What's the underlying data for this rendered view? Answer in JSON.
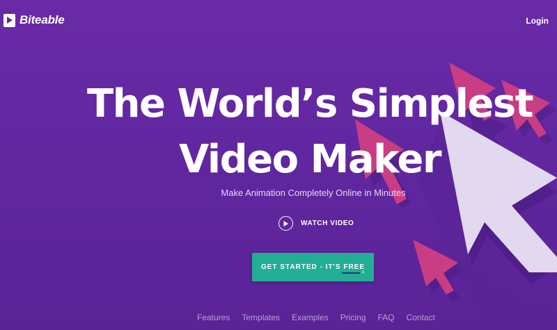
{
  "header": {
    "logo_text": "Biteable",
    "login_label": "Login"
  },
  "hero": {
    "headline_line1": "The World’s Simplest",
    "headline_line2": "Video Maker",
    "subheadline": "Make Animation Completely Online in Minutes",
    "watch_video_label": "WATCH VIDEO",
    "cta_label": "GET STARTED - IT'S FREE"
  },
  "footer": {
    "links": [
      "Features",
      "Templates",
      "Examples",
      "Pricing",
      "FAQ",
      "Contact"
    ]
  },
  "icons": {
    "logo": "play-icon",
    "watch": "play-circle-icon",
    "art": "cursor-arrow-icon"
  },
  "colors": {
    "background": "#6127a0",
    "cta": "#23ae96",
    "arrow_pink": "#c93d84",
    "arrow_light": "#e2d8ef",
    "footer_link": "#b9a2d6"
  }
}
